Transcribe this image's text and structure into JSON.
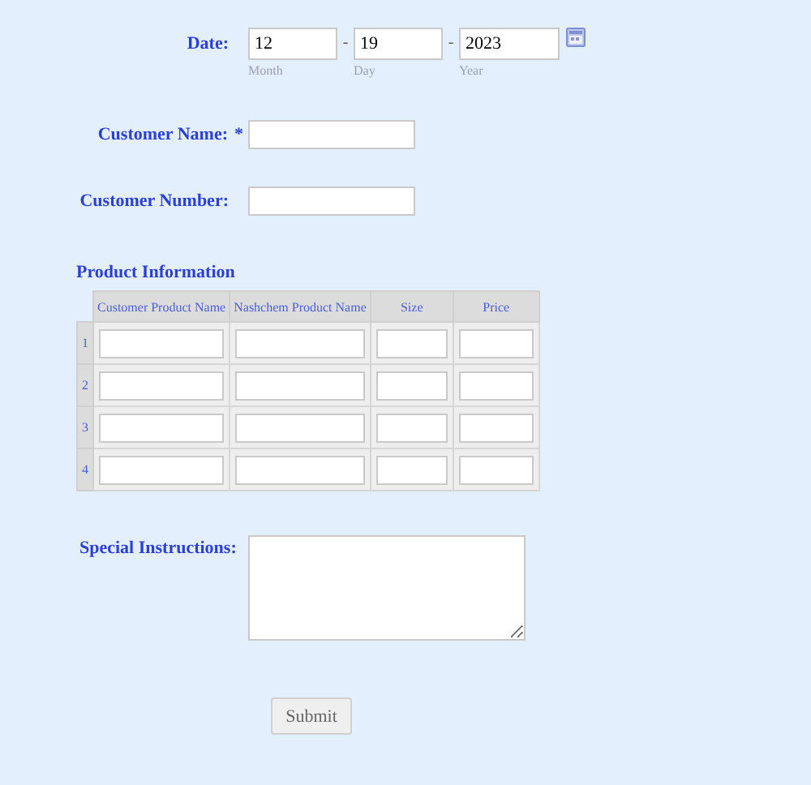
{
  "date": {
    "label": "Date:",
    "parts": [
      {
        "value": "12",
        "sublabel": "Month"
      },
      {
        "value": "19",
        "sublabel": "Day"
      },
      {
        "value": "2023",
        "sublabel": "Year"
      }
    ],
    "separator": "-"
  },
  "customer_name": {
    "label": "Customer Name:",
    "required_mark": "*"
  },
  "customer_number": {
    "label": "Customer Number:"
  },
  "product_information": {
    "title": "Product Information",
    "columns": [
      "Customer Product Name",
      "Nashchem Product Name",
      "Size",
      "Price"
    ],
    "rows": [
      "1",
      "2",
      "3",
      "4"
    ]
  },
  "special_instructions": {
    "label": "Special Instructions:"
  },
  "submit": {
    "label": "Submit"
  }
}
